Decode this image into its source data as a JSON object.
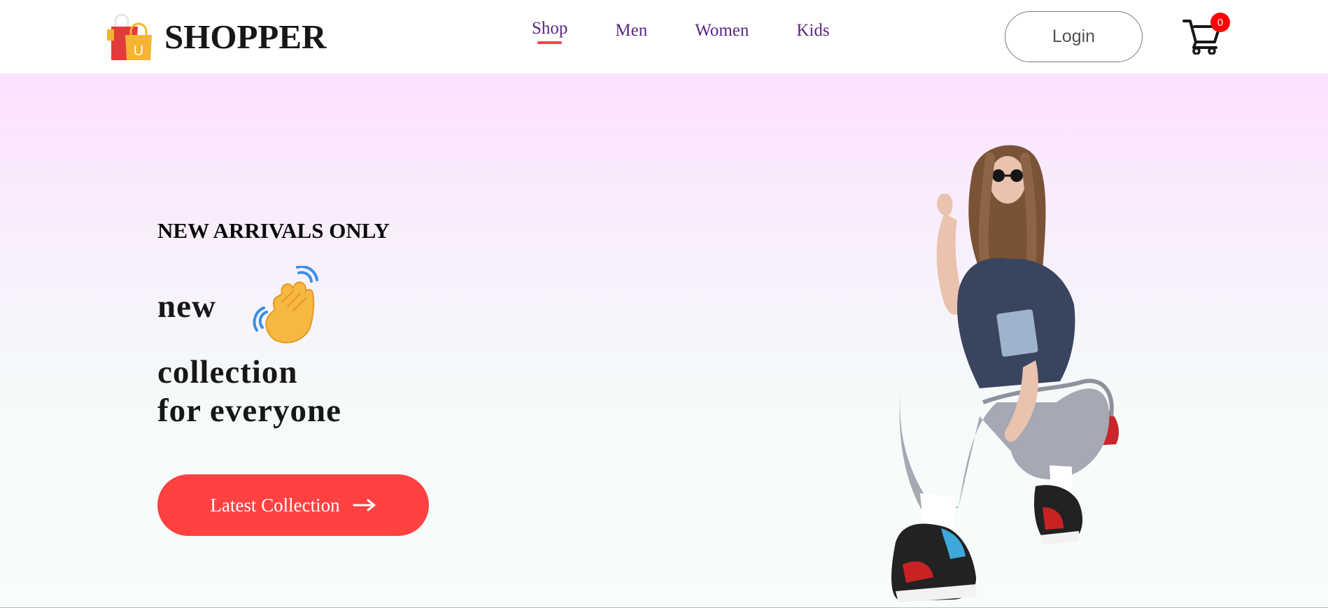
{
  "navbar": {
    "logo_text": "SHOPPER",
    "logo_bag_letter": "U",
    "menu": [
      {
        "label": "Shop",
        "active": true
      },
      {
        "label": "Men",
        "active": false
      },
      {
        "label": "Women",
        "active": false
      },
      {
        "label": "Kids",
        "active": false
      }
    ],
    "login_label": "Login",
    "cart_count": "0"
  },
  "hero": {
    "tagline": "NEW ARRIVALS ONLY",
    "line_1": "new",
    "line_2": "collection",
    "line_3": "for everyone",
    "cta_label": "Latest Collection",
    "hero_image": "woman-streetwear-photo"
  },
  "colors": {
    "accent": "#ff4141",
    "nav_text": "#5a2785",
    "hero_top": "#fde1ff",
    "hero_bottom": "#f6fdfa"
  }
}
